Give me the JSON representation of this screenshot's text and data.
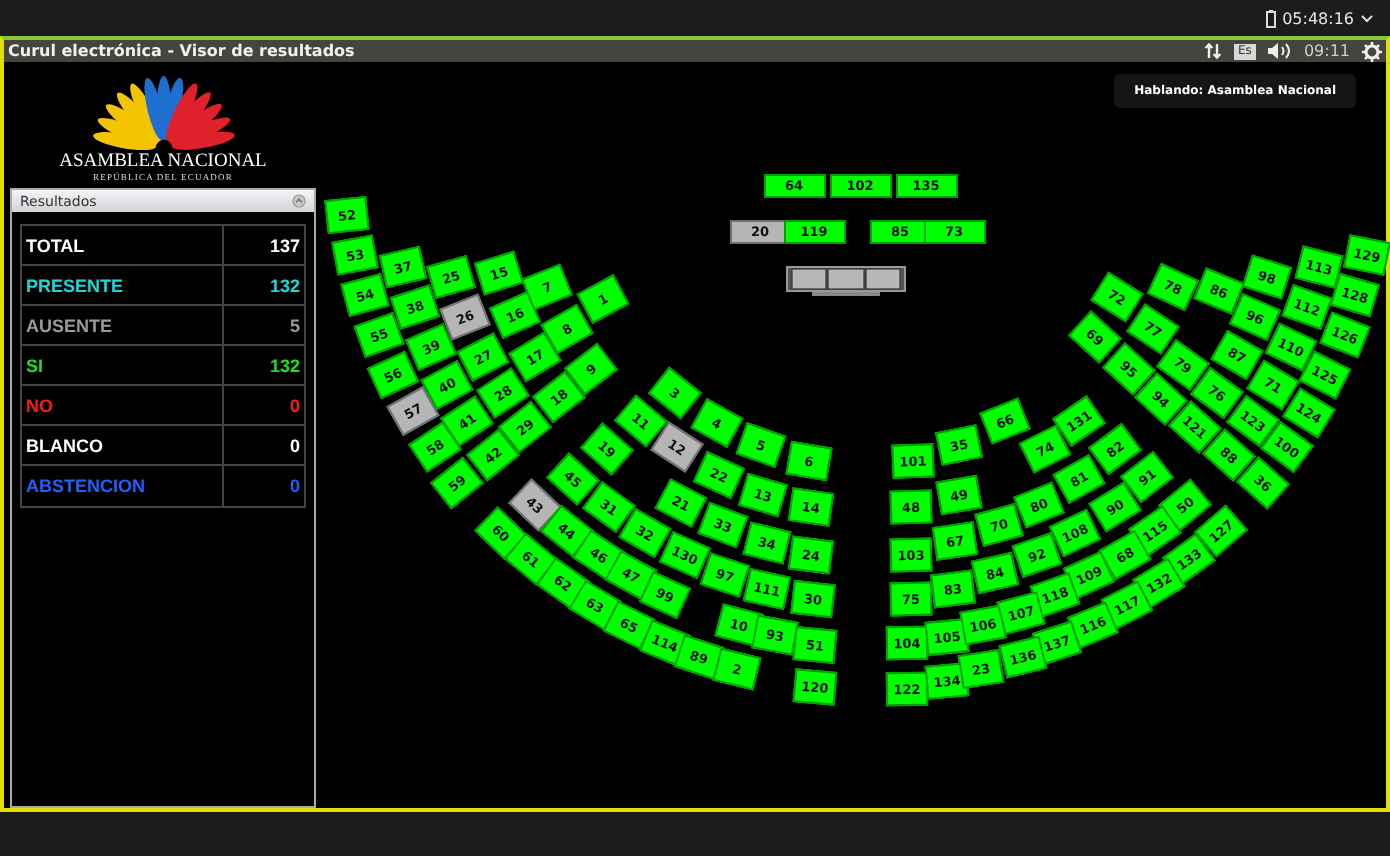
{
  "top_bar": {
    "clock": "05:48:16"
  },
  "window": {
    "title": "Curul electrónica - Visor de resultados",
    "keyboard_layout": "Es",
    "time": "09:11"
  },
  "logo": {
    "name": "ASAMBLEA NACIONAL",
    "subtitle": "REPÚBLICA DEL ECUADOR"
  },
  "speaking": "Hablando: Asamblea Nacional",
  "results": {
    "title": "Resultados",
    "rows": [
      {
        "label": "TOTAL",
        "value": "137",
        "kind": "total"
      },
      {
        "label": "PRESENTE",
        "value": "132",
        "kind": "present"
      },
      {
        "label": "AUSENTE",
        "value": "5",
        "kind": "absent"
      },
      {
        "label": "SI",
        "value": "132",
        "kind": "yes"
      },
      {
        "label": "NO",
        "value": "0",
        "kind": "no"
      },
      {
        "label": "BLANCO",
        "value": "0",
        "kind": "blank"
      },
      {
        "label": "ABSTENCION",
        "value": "0",
        "kind": "abstention"
      }
    ]
  },
  "bench_seats": [
    {
      "number": "64",
      "present": true
    },
    {
      "number": "102",
      "present": true
    },
    {
      "number": "135",
      "present": true
    },
    {
      "number": "20",
      "present": false
    },
    {
      "number": "119",
      "present": true
    },
    {
      "number": "85",
      "present": true
    },
    {
      "number": "73",
      "present": true
    }
  ],
  "seats": [
    {
      "number": "52",
      "present": true
    },
    {
      "number": "53",
      "present": true
    },
    {
      "number": "54",
      "present": true
    },
    {
      "number": "55",
      "present": true
    },
    {
      "number": "56",
      "present": true
    },
    {
      "number": "57",
      "present": false
    },
    {
      "number": "58",
      "present": true
    },
    {
      "number": "59",
      "present": true
    },
    {
      "number": "37",
      "present": true
    },
    {
      "number": "38",
      "present": true
    },
    {
      "number": "39",
      "present": true
    },
    {
      "number": "40",
      "present": true
    },
    {
      "number": "41",
      "present": true
    },
    {
      "number": "42",
      "present": true
    },
    {
      "number": "25",
      "present": true
    },
    {
      "number": "26",
      "present": false
    },
    {
      "number": "27",
      "present": true
    },
    {
      "number": "28",
      "present": true
    },
    {
      "number": "29",
      "present": true
    },
    {
      "number": "15",
      "present": true
    },
    {
      "number": "16",
      "present": true
    },
    {
      "number": "17",
      "present": true
    },
    {
      "number": "18",
      "present": true
    },
    {
      "number": "7",
      "present": true
    },
    {
      "number": "8",
      "present": true
    },
    {
      "number": "9",
      "present": true
    },
    {
      "number": "1",
      "present": true
    },
    {
      "number": "3",
      "present": true
    },
    {
      "number": "4",
      "present": true
    },
    {
      "number": "5",
      "present": true
    },
    {
      "number": "6",
      "present": true
    },
    {
      "number": "11",
      "present": true
    },
    {
      "number": "12",
      "present": false
    },
    {
      "number": "22",
      "present": true
    },
    {
      "number": "13",
      "present": true
    },
    {
      "number": "14",
      "present": true
    },
    {
      "number": "19",
      "present": true
    },
    {
      "number": "45",
      "present": true
    },
    {
      "number": "31",
      "present": true
    },
    {
      "number": "32",
      "present": true
    },
    {
      "number": "130",
      "present": true
    },
    {
      "number": "97",
      "present": true
    },
    {
      "number": "111",
      "present": true
    },
    {
      "number": "30",
      "present": true
    },
    {
      "number": "21",
      "present": true
    },
    {
      "number": "33",
      "present": true
    },
    {
      "number": "34",
      "present": true
    },
    {
      "number": "24",
      "present": true
    },
    {
      "number": "43",
      "present": false
    },
    {
      "number": "44",
      "present": true
    },
    {
      "number": "46",
      "present": true
    },
    {
      "number": "47",
      "present": true
    },
    {
      "number": "99",
      "present": true
    },
    {
      "number": "60",
      "present": true
    },
    {
      "number": "61",
      "present": true
    },
    {
      "number": "62",
      "present": true
    },
    {
      "number": "63",
      "present": true
    },
    {
      "number": "65",
      "present": true
    },
    {
      "number": "114",
      "present": true
    },
    {
      "number": "89",
      "present": true
    },
    {
      "number": "2",
      "present": true
    },
    {
      "number": "10",
      "present": true
    },
    {
      "number": "93",
      "present": true
    },
    {
      "number": "51",
      "present": true
    },
    {
      "number": "120",
      "present": true
    },
    {
      "number": "72",
      "present": true
    },
    {
      "number": "69",
      "present": true
    },
    {
      "number": "78",
      "present": true
    },
    {
      "number": "77",
      "present": true
    },
    {
      "number": "95",
      "present": true
    },
    {
      "number": "86",
      "present": true
    },
    {
      "number": "79",
      "present": true
    },
    {
      "number": "94",
      "present": true
    },
    {
      "number": "98",
      "present": true
    },
    {
      "number": "96",
      "present": true
    },
    {
      "number": "87",
      "present": true
    },
    {
      "number": "76",
      "present": true
    },
    {
      "number": "121",
      "present": true
    },
    {
      "number": "113",
      "present": true
    },
    {
      "number": "112",
      "present": true
    },
    {
      "number": "110",
      "present": true
    },
    {
      "number": "71",
      "present": true
    },
    {
      "number": "123",
      "present": true
    },
    {
      "number": "88",
      "present": true
    },
    {
      "number": "129",
      "present": true
    },
    {
      "number": "128",
      "present": true
    },
    {
      "number": "126",
      "present": true
    },
    {
      "number": "125",
      "present": true
    },
    {
      "number": "124",
      "present": true
    },
    {
      "number": "100",
      "present": true
    },
    {
      "number": "36",
      "present": true
    },
    {
      "number": "101",
      "present": true
    },
    {
      "number": "35",
      "present": true
    },
    {
      "number": "66",
      "present": true
    },
    {
      "number": "48",
      "present": true
    },
    {
      "number": "49",
      "present": true
    },
    {
      "number": "74",
      "present": true
    },
    {
      "number": "131",
      "present": true
    },
    {
      "number": "82",
      "present": true
    },
    {
      "number": "81",
      "present": true
    },
    {
      "number": "91",
      "present": true
    },
    {
      "number": "80",
      "present": true
    },
    {
      "number": "90",
      "present": true
    },
    {
      "number": "50",
      "present": true
    },
    {
      "number": "103",
      "present": true
    },
    {
      "number": "67",
      "present": true
    },
    {
      "number": "70",
      "present": true
    },
    {
      "number": "108",
      "present": true
    },
    {
      "number": "115",
      "present": true
    },
    {
      "number": "127",
      "present": true
    },
    {
      "number": "92",
      "present": true
    },
    {
      "number": "68",
      "present": true
    },
    {
      "number": "133",
      "present": true
    },
    {
      "number": "75",
      "present": true
    },
    {
      "number": "83",
      "present": true
    },
    {
      "number": "84",
      "present": true
    },
    {
      "number": "109",
      "present": true
    },
    {
      "number": "132",
      "present": true
    },
    {
      "number": "118",
      "present": true
    },
    {
      "number": "117",
      "present": true
    },
    {
      "number": "104",
      "present": true
    },
    {
      "number": "105",
      "present": true
    },
    {
      "number": "106",
      "present": true
    },
    {
      "number": "107",
      "present": true
    },
    {
      "number": "116",
      "present": true
    },
    {
      "number": "137",
      "present": true
    },
    {
      "number": "122",
      "present": true
    },
    {
      "number": "134",
      "present": true
    },
    {
      "number": "23",
      "present": true
    },
    {
      "number": "136",
      "present": true
    }
  ]
}
